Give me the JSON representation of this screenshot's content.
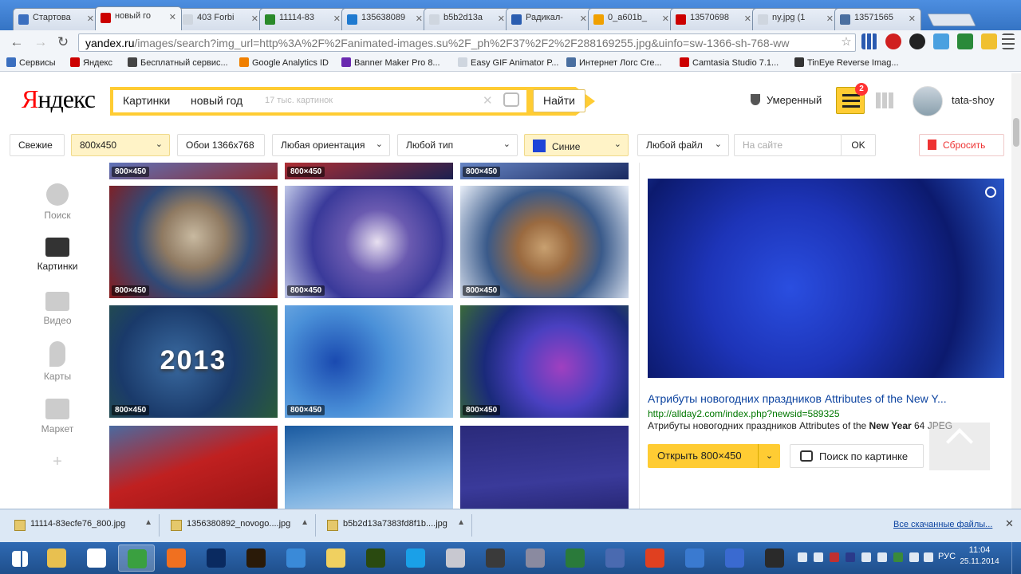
{
  "browser": {
    "tabs": [
      {
        "label": "Стартова",
        "color": "#3b6fbf"
      },
      {
        "label": "новый го",
        "color": "#cc0000",
        "active": true
      },
      {
        "label": "403 Forbi",
        "color": "#cfd6df"
      },
      {
        "label": "11114-83",
        "color": "#2a8a2a"
      },
      {
        "label": "135638089",
        "color": "#1f7ad0"
      },
      {
        "label": "b5b2d13a",
        "color": "#cfd6df"
      },
      {
        "label": "Радикал-",
        "color": "#2a5db0"
      },
      {
        "label": "0_a601b_",
        "color": "#f0a000"
      },
      {
        "label": "13570698",
        "color": "#cc0000"
      },
      {
        "label": "ny.jpg (1",
        "color": "#cfd6df"
      },
      {
        "label": "13571565",
        "color": "#4a6fa0"
      }
    ],
    "url_host": "yandex.ru",
    "url_rest": "/images/search?img_url=http%3A%2F%2Fanimated-images.su%2F_ph%2F37%2F2%2F288169255.jpg&uinfo=sw-1366-sh-768-ww"
  },
  "bookmarks": [
    {
      "label": "Сервисы",
      "color": "#3b6fbf"
    },
    {
      "label": "Яндекс",
      "color": "#cc0000"
    },
    {
      "label": "Бесплатный сервис...",
      "color": "#444444"
    },
    {
      "label": "Google Analytics ID",
      "color": "#f08000"
    },
    {
      "label": "Banner Maker Pro 8...",
      "color": "#6a2ab0"
    },
    {
      "label": "Easy GIF Animator P...",
      "color": "#cfd6df"
    },
    {
      "label": "Интернет Логс Cre...",
      "color": "#4a6fa0"
    },
    {
      "label": "Camtasia Studio 7.1...",
      "color": "#cc0000"
    },
    {
      "label": "TinEye Reverse Imag...",
      "color": "#333333"
    }
  ],
  "header": {
    "logo_ya": "Я",
    "logo_rest": "ндекс",
    "search_tag": "Картинки",
    "search_query": "новый год",
    "search_count": "17 тыс. картинок",
    "search_button": "Найти",
    "safe_search": "Умеренный",
    "filters_badge": "2",
    "username": "tata-shoy"
  },
  "filters": {
    "fresh": "Свежие",
    "size": "800x450",
    "wallpaper": "Обои 1366x768",
    "orientation": "Любая ориентация",
    "type": "Любой тип",
    "color": "Синие",
    "file": "Любой файл",
    "site_placeholder": "На сайте",
    "ok": "OK",
    "reset": "Сбросить"
  },
  "sidebar": {
    "items": [
      {
        "label": "Поиск"
      },
      {
        "label": "Картинки"
      },
      {
        "label": "Видео"
      },
      {
        "label": "Карты"
      },
      {
        "label": "Маркет"
      }
    ],
    "add": "+"
  },
  "results": [
    {
      "size": "800×450",
      "bg": "linear-gradient(160deg,#2b4b8f,#5a7cc9,#8a2a30)"
    },
    {
      "size": "800×450",
      "bg": "linear-gradient(160deg,#3a3d70,#c03030,#1a2050)"
    },
    {
      "size": "800×450",
      "bg": "linear-gradient(160deg,#2a4a9a,#7090d0,#1a2a60)"
    },
    {
      "size": "800×450",
      "bg": "radial-gradient(circle at 50% 45%,#c8b9a0 0,#8f7a62 30%,#304a78 55%,#8a1a1a 100%)"
    },
    {
      "size": "800×450",
      "bg": "radial-gradient(circle at 55% 50%,#e8e0f0 0,#6a5ab0 30%,#3a3a9a 60%,#c0c8e8 100%)"
    },
    {
      "size": "800×450",
      "bg": "radial-gradient(circle at 50% 55%,#c8a070 0,#9a6a40 25%,#3a5a8a 55%,#e8eef8 100%)"
    },
    {
      "size": "800×450",
      "bg": "radial-gradient(circle at 40% 50%,#3a6aa0 0,#1a3a6a 50%,#2a5a3a 100%)",
      "caption": "2013"
    },
    {
      "size": "800×450",
      "bg": "radial-gradient(circle at 30% 50%,#1a4ab0 0,#4a90d8 40%,#a8d0f0 100%)"
    },
    {
      "size": "800×450",
      "bg": "radial-gradient(circle at 60% 55%,#a040c0 0,#4a40c0 35%,#1a2a7a 65%,#3a6a3a 100%)"
    },
    {
      "size": "",
      "bg": "linear-gradient(160deg,#4a6aa0,#c02020 40%,#8a1010 100%)"
    },
    {
      "size": "",
      "bg": "linear-gradient(170deg,#1a5aa0,#7ab0e0 50%,#e8f0fa 100%)"
    },
    {
      "size": "",
      "bg": "linear-gradient(175deg,#2a2a7a,#3a3a9a 50%,#1a1a5a 100%)"
    }
  ],
  "preview": {
    "title": "Атрибуты новогодних праздников Attributes of the New Y...",
    "url": "http://allday2.com/index.php?newsid=589325",
    "desc_pre": "Атрибуты новогодних праздников Attributes of the ",
    "desc_bold": "New Year",
    "desc_post": " 64 JPEG",
    "open_label": "Открыть 800×450",
    "search_by_label": "Поиск по картинке"
  },
  "downloads": {
    "items": [
      {
        "label": "11114-83ecfe76_800.jpg"
      },
      {
        "label": "1356380892_novogo....jpg"
      },
      {
        "label": "b5b2d13a7383fd8f1b....jpg"
      }
    ],
    "all_link": "Все скачанные файлы..."
  },
  "taskbar": {
    "apps": [
      {
        "name": "explorer",
        "color": "#e8c050"
      },
      {
        "name": "hp",
        "color": "#ffffff"
      },
      {
        "name": "chrome",
        "color": "#3aa040"
      },
      {
        "name": "firefox",
        "color": "#f07020"
      },
      {
        "name": "photoshop",
        "color": "#0a2a60"
      },
      {
        "name": "muse",
        "color": "#2a1a08"
      },
      {
        "name": "internet-explorer",
        "color": "#3a8ad8"
      },
      {
        "name": "folder",
        "color": "#f0d060"
      },
      {
        "name": "dreamweaver",
        "color": "#2a4a10"
      },
      {
        "name": "skype",
        "color": "#1aa0e8"
      },
      {
        "name": "paint",
        "color": "#c8c8d0"
      },
      {
        "name": "character",
        "color": "#3a3a3a"
      },
      {
        "name": "tool",
        "color": "#8a8aa0"
      },
      {
        "name": "excel",
        "color": "#2a7a3a"
      },
      {
        "name": "document",
        "color": "#4a6ab0"
      },
      {
        "name": "recorder",
        "color": "#e04020"
      },
      {
        "name": "notepad",
        "color": "#3a7ad0"
      },
      {
        "name": "network",
        "color": "#3a6ad0"
      },
      {
        "name": "pen",
        "color": "#2a2a2a"
      }
    ],
    "lang": "РУС",
    "time": "11:04",
    "date": "25.11.2014"
  }
}
